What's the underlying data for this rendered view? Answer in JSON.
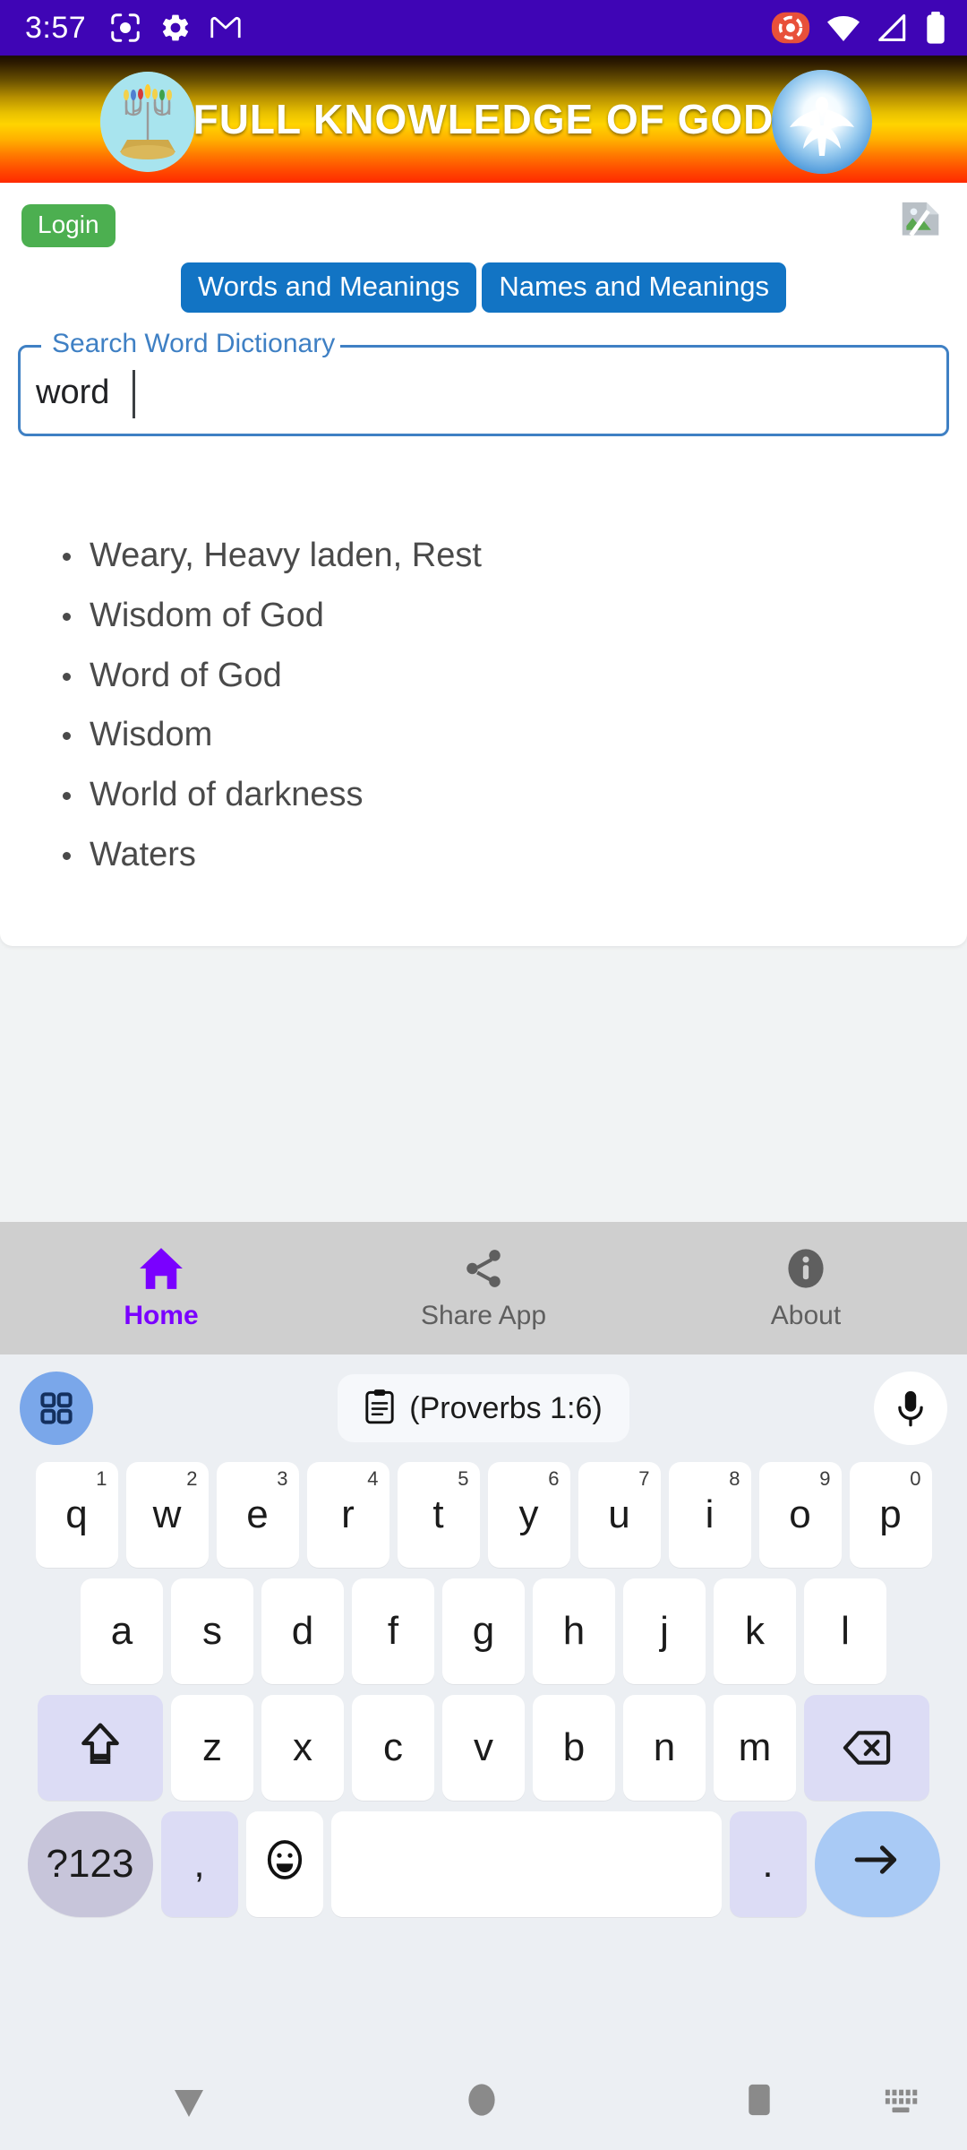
{
  "status_bar": {
    "time": "3:57",
    "left_icons": [
      "screen-record-icon",
      "settings-gear-icon",
      "gmail-icon"
    ],
    "right_icons": [
      "recording-active-icon",
      "wifi-icon",
      "cellular-signal-icon",
      "battery-icon"
    ],
    "background_color": "#3f05b5"
  },
  "banner": {
    "title": "FULL KNOWLEDGE OF GOD",
    "left_logo": "menorah-logo",
    "right_logo": "dove-logo",
    "gradient_from": "#1a0d00",
    "gradient_to": "#ff2a00"
  },
  "app": {
    "login_label": "Login",
    "login_color": "#4caf50",
    "broken_image": "broken-image-placeholder",
    "tabs": [
      {
        "label": "Words and Meanings"
      },
      {
        "label": "Names and Meanings"
      }
    ],
    "tab_color": "#1274c4",
    "search": {
      "label": "Search Word Dictionary",
      "value": "word",
      "placeholder": "",
      "outline_color": "#3f80c4"
    },
    "results": [
      "Weary, Heavy laden, Rest",
      "Wisdom of God",
      "Word of God",
      "Wisdom",
      "World of darkness",
      "Waters"
    ]
  },
  "bottom_nav": {
    "items": [
      {
        "label": "Home",
        "icon": "home-icon",
        "active": true
      },
      {
        "label": "Share App",
        "icon": "share-icon",
        "active": false
      },
      {
        "label": "About",
        "icon": "info-icon",
        "active": false
      }
    ],
    "active_color": "#7a00ff",
    "background_color": "#cfcfcf"
  },
  "keyboard": {
    "toolbar": {
      "grid_icon": "app-grid-icon",
      "clipboard_icon": "clipboard-icon",
      "clipboard_text": "(Proverbs 1:6)",
      "mic_icon": "microphone-icon"
    },
    "row1": [
      {
        "key": "q",
        "hint": "1"
      },
      {
        "key": "w",
        "hint": "2"
      },
      {
        "key": "e",
        "hint": "3"
      },
      {
        "key": "r",
        "hint": "4"
      },
      {
        "key": "t",
        "hint": "5"
      },
      {
        "key": "y",
        "hint": "6"
      },
      {
        "key": "u",
        "hint": "7"
      },
      {
        "key": "i",
        "hint": "8"
      },
      {
        "key": "o",
        "hint": "9"
      },
      {
        "key": "p",
        "hint": "0"
      }
    ],
    "row2": [
      {
        "key": "a"
      },
      {
        "key": "s"
      },
      {
        "key": "d"
      },
      {
        "key": "f"
      },
      {
        "key": "g"
      },
      {
        "key": "h"
      },
      {
        "key": "j"
      },
      {
        "key": "k"
      },
      {
        "key": "l"
      }
    ],
    "row3": [
      {
        "key": "z"
      },
      {
        "key": "x"
      },
      {
        "key": "c"
      },
      {
        "key": "v"
      },
      {
        "key": "b"
      },
      {
        "key": "n"
      },
      {
        "key": "m"
      }
    ],
    "shift_icon": "shift-icon",
    "backspace_icon": "backspace-icon",
    "symbols_label": "?123",
    "comma_label": ",",
    "emoji_icon": "emoji-icon",
    "space_label": "",
    "period_label": ".",
    "enter_icon": "enter-arrow-icon"
  },
  "android_nav": {
    "back_icon": "keyboard-dismiss-icon",
    "home_icon": "home-pill-icon",
    "recents_icon": "recents-square-icon",
    "keyboard_switch_icon": "keyboard-switch-icon"
  }
}
